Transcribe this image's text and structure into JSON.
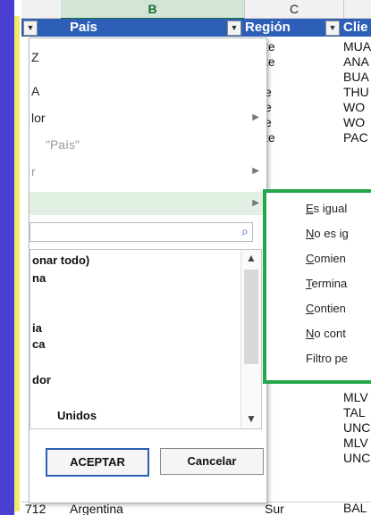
{
  "columns": {
    "b": "B",
    "c": "C"
  },
  "header": {
    "pais": "País",
    "region": "Región",
    "cliente": "Clie"
  },
  "region_vals": [
    "te",
    "te",
    "",
    "e",
    "e",
    "e",
    "te"
  ],
  "cliente_vals": [
    "MUA",
    "ANA",
    "BUA",
    "THU",
    "WO",
    "WO",
    "PAC"
  ],
  "cliente_vals2": [
    "MLV",
    "TAL",
    "UNC",
    "MLV",
    "UNC",
    "BAL"
  ],
  "menu": {
    "sort_az": "Z",
    "sort_za": "A",
    "sort_color": "lor",
    "clear": "\"País\"",
    "filter_color": "r",
    "text_filters": ""
  },
  "search_placeholder": "",
  "list": [
    "onar todo)",
    "na",
    "ia",
    "ca",
    "dor",
    "Unidos"
  ],
  "buttons": {
    "ok": "ACEPTAR",
    "cancel": "Cancelar"
  },
  "submenu": [
    {
      "key": "E",
      "rest": "s igual"
    },
    {
      "key": "N",
      "rest": "o es ig"
    },
    {
      "key": "C",
      "rest": "omien"
    },
    {
      "key": "T",
      "rest": "ermina"
    },
    {
      "key": "C",
      "rest": "ontien"
    },
    {
      "key": "N",
      "rest": "o cont"
    },
    {
      "key": "",
      "rest": "Filtro pe"
    }
  ],
  "last_row": {
    "num": "712",
    "country": "Argentina",
    "region": "Sur"
  }
}
